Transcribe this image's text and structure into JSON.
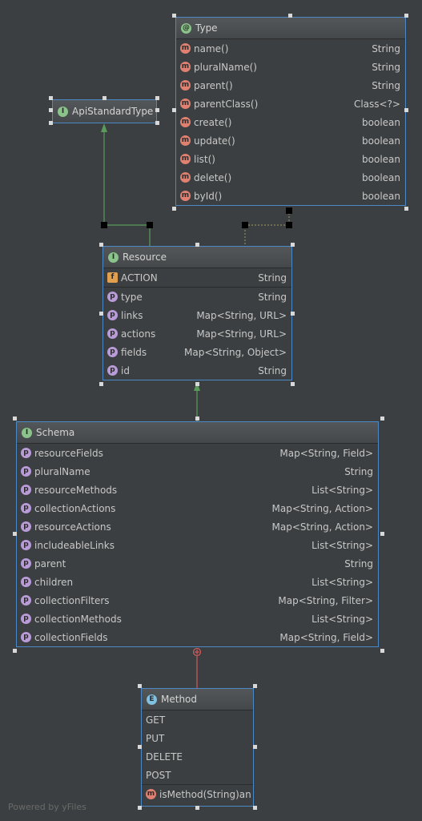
{
  "watermark": "Powered by yFiles",
  "type_box": {
    "badge": "@",
    "title": "Type",
    "rows": [
      {
        "name": "name()",
        "type": "String"
      },
      {
        "name": "pluralName()",
        "type": "String"
      },
      {
        "name": "parent()",
        "type": "String"
      },
      {
        "name": "parentClass()",
        "type": "Class<?>"
      },
      {
        "name": "create()",
        "type": "boolean"
      },
      {
        "name": "update()",
        "type": "boolean"
      },
      {
        "name": "list()",
        "type": "boolean"
      },
      {
        "name": "delete()",
        "type": "boolean"
      },
      {
        "name": "byId()",
        "type": "boolean"
      }
    ]
  },
  "api_box": {
    "badge": "I",
    "title": "ApiStandardType"
  },
  "resource_box": {
    "badge": "I",
    "title": "Resource",
    "field_row": {
      "name": "ACTION",
      "type": "String"
    },
    "rows": [
      {
        "name": "type",
        "type": "String"
      },
      {
        "name": "links",
        "type": "Map<String, URL>"
      },
      {
        "name": "actions",
        "type": "Map<String, URL>"
      },
      {
        "name": "fields",
        "type": "Map<String, Object>"
      },
      {
        "name": "id",
        "type": "String"
      }
    ]
  },
  "schema_box": {
    "badge": "I",
    "title": "Schema",
    "rows": [
      {
        "name": "resourceFields",
        "type": "Map<String, Field>"
      },
      {
        "name": "pluralName",
        "type": "String"
      },
      {
        "name": "resourceMethods",
        "type": "List<String>"
      },
      {
        "name": "collectionActions",
        "type": "Map<String, Action>"
      },
      {
        "name": "resourceActions",
        "type": "Map<String, Action>"
      },
      {
        "name": "includeableLinks",
        "type": "List<String>"
      },
      {
        "name": "parent",
        "type": "String"
      },
      {
        "name": "children",
        "type": "List<String>"
      },
      {
        "name": "collectionFilters",
        "type": "Map<String, Filter>"
      },
      {
        "name": "collectionMethods",
        "type": "List<String>"
      },
      {
        "name": "collectionFields",
        "type": "Map<String, Field>"
      }
    ]
  },
  "method_box": {
    "badge": "E",
    "title": "Method",
    "constants": [
      "GET",
      "PUT",
      "DELETE",
      "POST"
    ],
    "method": {
      "name": "isMethod(String)",
      "type": "an"
    }
  },
  "icons": {
    "method": "m",
    "property": "p",
    "field": "f"
  },
  "colors": {
    "background": "#3c3f41",
    "border": "#4a88c7",
    "inherit_line": "#5a9a5a",
    "nest_line": "#d05a5a"
  }
}
